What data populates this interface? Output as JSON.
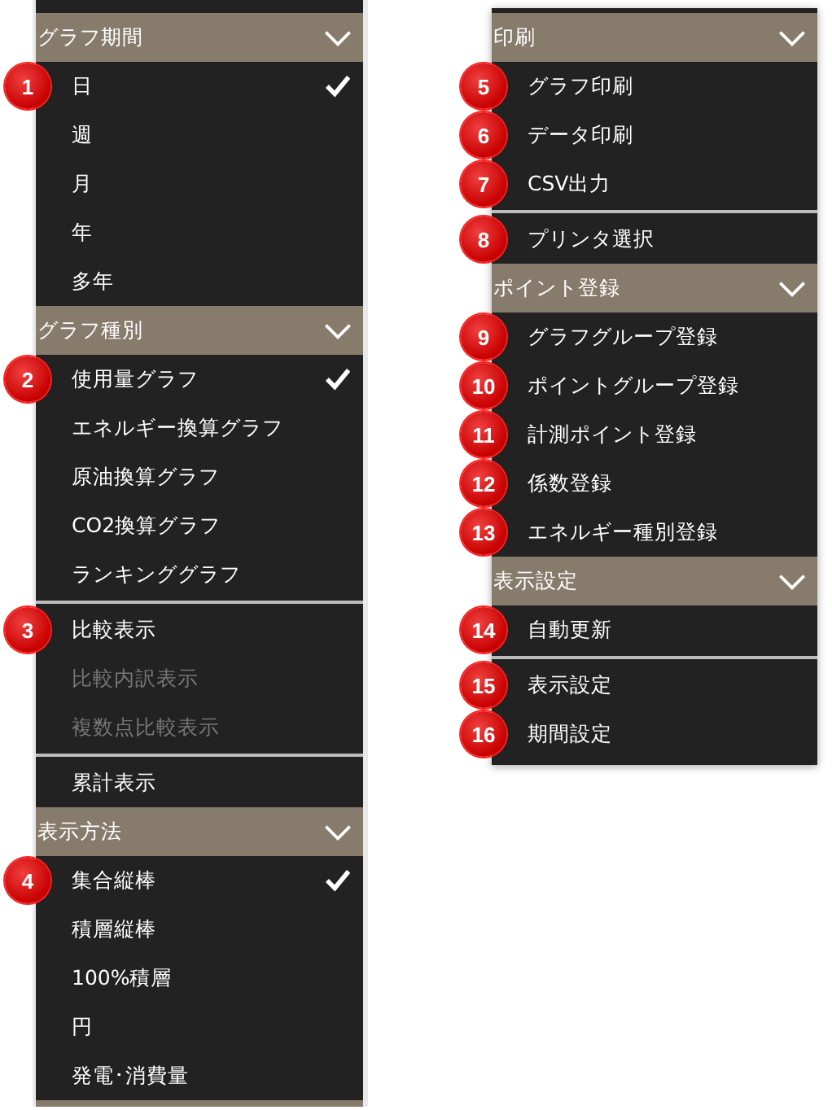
{
  "menus": [
    {
      "entries": [
        {
          "kind": "header",
          "title": "グラフ期間"
        },
        {
          "kind": "item",
          "label": "日",
          "checked": true,
          "disabled": false,
          "badge": "1"
        },
        {
          "kind": "item",
          "label": "週",
          "checked": false,
          "disabled": false
        },
        {
          "kind": "item",
          "label": "月",
          "checked": false,
          "disabled": false
        },
        {
          "kind": "item",
          "label": "年",
          "checked": false,
          "disabled": false
        },
        {
          "kind": "item",
          "label": "多年",
          "checked": false,
          "disabled": false
        },
        {
          "kind": "header",
          "title": "グラフ種別"
        },
        {
          "kind": "item",
          "label": "使用量グラフ",
          "checked": true,
          "disabled": false,
          "badge": "2"
        },
        {
          "kind": "item",
          "label": "エネルギー換算グラフ",
          "checked": false,
          "disabled": false
        },
        {
          "kind": "item",
          "label": "原油換算グラフ",
          "checked": false,
          "disabled": false
        },
        {
          "kind": "item",
          "label": "CO2換算グラフ",
          "checked": false,
          "disabled": false
        },
        {
          "kind": "item",
          "label": "ランキンググラフ",
          "checked": false,
          "disabled": false
        },
        {
          "kind": "divider"
        },
        {
          "kind": "item",
          "label": "比較表示",
          "checked": false,
          "disabled": false,
          "badge": "3"
        },
        {
          "kind": "item",
          "label": "比較内訳表示",
          "checked": false,
          "disabled": true
        },
        {
          "kind": "item",
          "label": "複数点比較表示",
          "checked": false,
          "disabled": true
        },
        {
          "kind": "divider"
        },
        {
          "kind": "item",
          "label": "累計表示",
          "checked": false,
          "disabled": false
        },
        {
          "kind": "header",
          "title": "表示方法"
        },
        {
          "kind": "item",
          "label": "集合縦棒",
          "checked": true,
          "disabled": false,
          "badge": "4"
        },
        {
          "kind": "item",
          "label": "積層縦棒",
          "checked": false,
          "disabled": false
        },
        {
          "kind": "item",
          "label": "100%積層",
          "checked": false,
          "disabled": false
        },
        {
          "kind": "item",
          "label": "円",
          "checked": false,
          "disabled": false
        },
        {
          "kind": "item",
          "label": "発電･消費量",
          "checked": false,
          "disabled": false
        }
      ]
    },
    {
      "entries": [
        {
          "kind": "header",
          "title": "印刷"
        },
        {
          "kind": "item",
          "label": "グラフ印刷",
          "badge": "5"
        },
        {
          "kind": "item",
          "label": "データ印刷",
          "badge": "6"
        },
        {
          "kind": "item",
          "label": "CSV出力",
          "badge": "7"
        },
        {
          "kind": "divider"
        },
        {
          "kind": "item",
          "label": "プリンタ選択",
          "badge": "8"
        },
        {
          "kind": "header",
          "title": "ポイント登録"
        },
        {
          "kind": "item",
          "label": "グラフグループ登録",
          "badge": "9"
        },
        {
          "kind": "item",
          "label": "ポイントグループ登録",
          "badge": "10"
        },
        {
          "kind": "item",
          "label": "計測ポイント登録",
          "badge": "11"
        },
        {
          "kind": "item",
          "label": "係数登録",
          "badge": "12"
        },
        {
          "kind": "item",
          "label": "エネルギー種別登録",
          "badge": "13"
        },
        {
          "kind": "header",
          "title": "表示設定"
        },
        {
          "kind": "item",
          "label": "自動更新",
          "badge": "14"
        },
        {
          "kind": "divider"
        },
        {
          "kind": "item",
          "label": "表示設定",
          "badge": "15"
        },
        {
          "kind": "item",
          "label": "期間設定",
          "badge": "16"
        }
      ]
    }
  ]
}
